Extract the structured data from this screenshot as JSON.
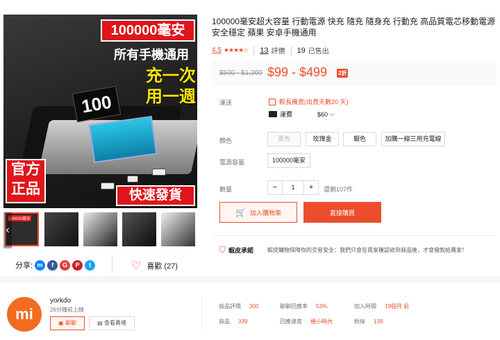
{
  "hero": {
    "capacity_badge": "100000毫安",
    "compat_text": "所有手機通用",
    "charge_once": "充一次",
    "use_week": "用一週",
    "official_1": "官方",
    "official_2": "正品",
    "fast_ship": "快速發貨",
    "display_value": "100"
  },
  "thumbnails": [
    {
      "label": "100000毫安"
    },
    {
      "label": ""
    },
    {
      "label": ""
    },
    {
      "label": ""
    },
    {
      "label": ""
    }
  ],
  "share": {
    "label": "分享:"
  },
  "favorite": {
    "label": "喜歡 (27)"
  },
  "product": {
    "title": "100000毫安超大容量 行動電源 快充 隨充 隨身充 行動充 高品質電芯移動電源 安全穩定 蘋果 安卓手機通用",
    "rating": "4.5",
    "reviews_count": "13",
    "reviews_label": "評價",
    "sold_count": "19",
    "sold_label": "已售出",
    "old_price": "$500 - $1,200",
    "price": "$99 - $499",
    "discount": "2折"
  },
  "shipping": {
    "label": "運送",
    "preorder": "較長備貨(出貨天數20 天)",
    "method_label": "運費",
    "fee": "$60"
  },
  "options": {
    "color_label": "顏色",
    "colors": [
      "黑色",
      "玫瑰金",
      "銀色",
      "加購一線三用充電線"
    ],
    "capacity_label": "電源容量",
    "capacity_value": "100000毫安",
    "qty_label": "數量",
    "qty_minus": "−",
    "qty_value": "1",
    "qty_plus": "+",
    "stock": "還剩107件"
  },
  "actions": {
    "cart": "加入購物車",
    "buy": "直接購買"
  },
  "guarantee": {
    "title": "蝦皮承諾",
    "text": "蝦皮購物保障你的交易安全：我們只會在買家確認收到商品後，才會撥款給賣家！"
  },
  "shop": {
    "avatar_text": "mi",
    "name": "yorkdo",
    "online": "26分鐘前上線",
    "chat": "聊聊",
    "visit": "查看賣場",
    "stats": {
      "rating_label": "商品評價",
      "rating_value": "300",
      "reply_label": "聊聊回應率",
      "reply_value": "53%",
      "joined_label": "加入時間",
      "joined_value": "19個月 前",
      "products_label": "商品",
      "products_value": "339",
      "reply_speed_label": "回應速度",
      "reply_speed_value": "幾小時內",
      "followers_label": "粉絲",
      "followers_value": "139"
    }
  },
  "colors": {
    "accent": "#ee4d2d",
    "badge_red": "#e0151b",
    "yellow": "#ffe500"
  }
}
